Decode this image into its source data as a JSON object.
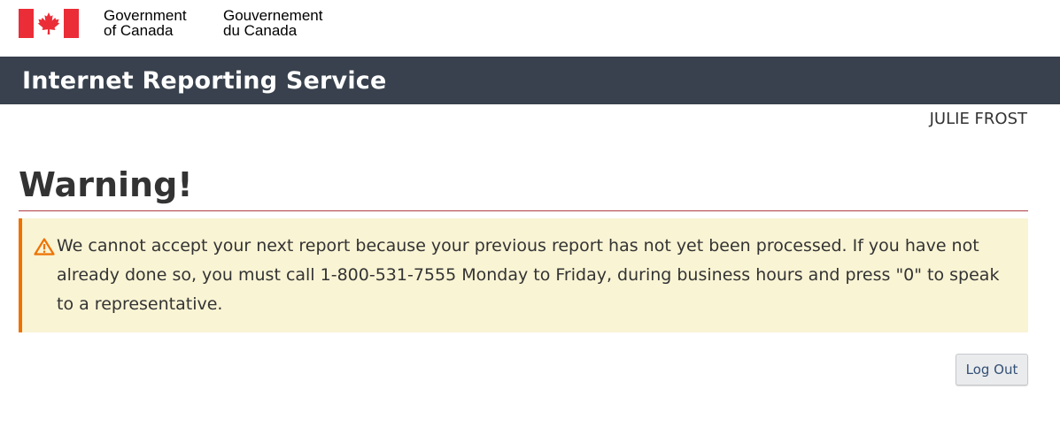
{
  "gov_header": {
    "signature_en": [
      "Government",
      "of Canada"
    ],
    "signature_fr": [
      "Gouvernement",
      "du Canada"
    ],
    "flag_color": "#eb2d37"
  },
  "app_bar": {
    "title": "Internet Reporting Service",
    "background": "#38414d"
  },
  "user": {
    "name": "JULIE FROST"
  },
  "page": {
    "title": "Warning!"
  },
  "alert": {
    "icon": "warning-triangle-icon",
    "message": "We cannot accept your next report because your previous report has not yet been processed. If you have not already done so, you must call 1-800-531-7555 Monday to Friday, during business hours and press \"0\" to speak to a representative.",
    "accent_color": "#ee7100",
    "background": "#f9f4d4"
  },
  "actions": {
    "logout_label": "Log Out"
  }
}
